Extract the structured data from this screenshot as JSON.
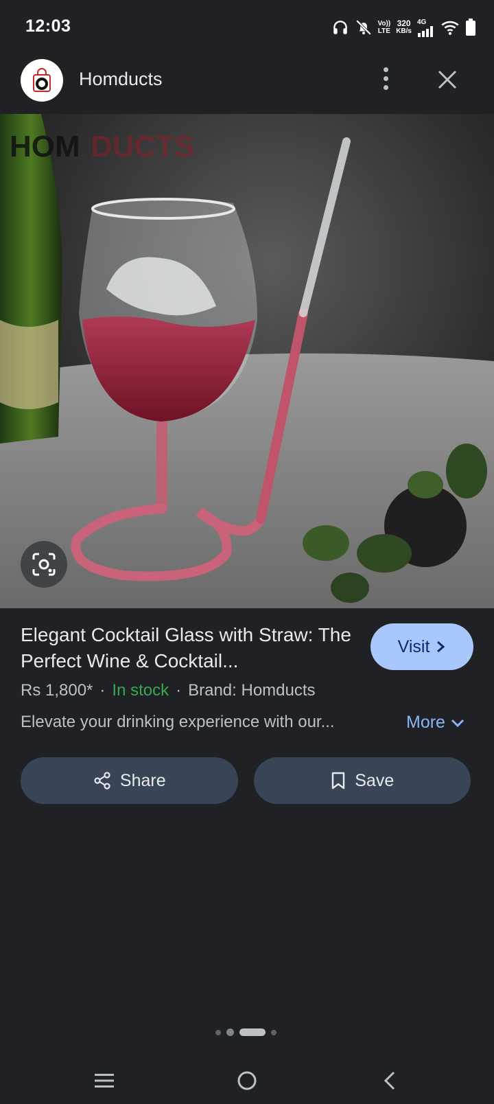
{
  "status_bar": {
    "time": "12:03",
    "volte_top": "Vo))",
    "volte_bottom": "LTE",
    "speed_top": "320",
    "speed_bottom": "KB/s",
    "network": "4G"
  },
  "header": {
    "site_name": "Homducts"
  },
  "hero_image": {
    "watermark_dark": "HOM",
    "watermark_red": "DUCTS"
  },
  "product": {
    "title": "Elegant Cocktail Glass with Straw: The Perfect Wine & Cocktail...",
    "price": "Rs 1,800*",
    "separator": "·",
    "stock": "In stock",
    "brand": "Brand: Homducts",
    "description": "Elevate your drinking experience with our...",
    "more_label": "More",
    "visit_label": "Visit"
  },
  "actions": {
    "share_label": "Share",
    "save_label": "Save"
  },
  "colors": {
    "background": "#202124",
    "visit_button": "#a8c7fa",
    "action_button": "#394457",
    "in_stock": "#34a853",
    "link": "#8ab4f8"
  },
  "icons": [
    "headphones-icon",
    "bell-off-icon",
    "signal-icon",
    "wifi-icon",
    "battery-icon",
    "more-vert-icon",
    "close-icon",
    "lens-icon",
    "chevron-right-icon",
    "chevron-down-icon",
    "share-icon",
    "bookmark-icon",
    "menu-icon",
    "home-icon",
    "back-icon"
  ]
}
